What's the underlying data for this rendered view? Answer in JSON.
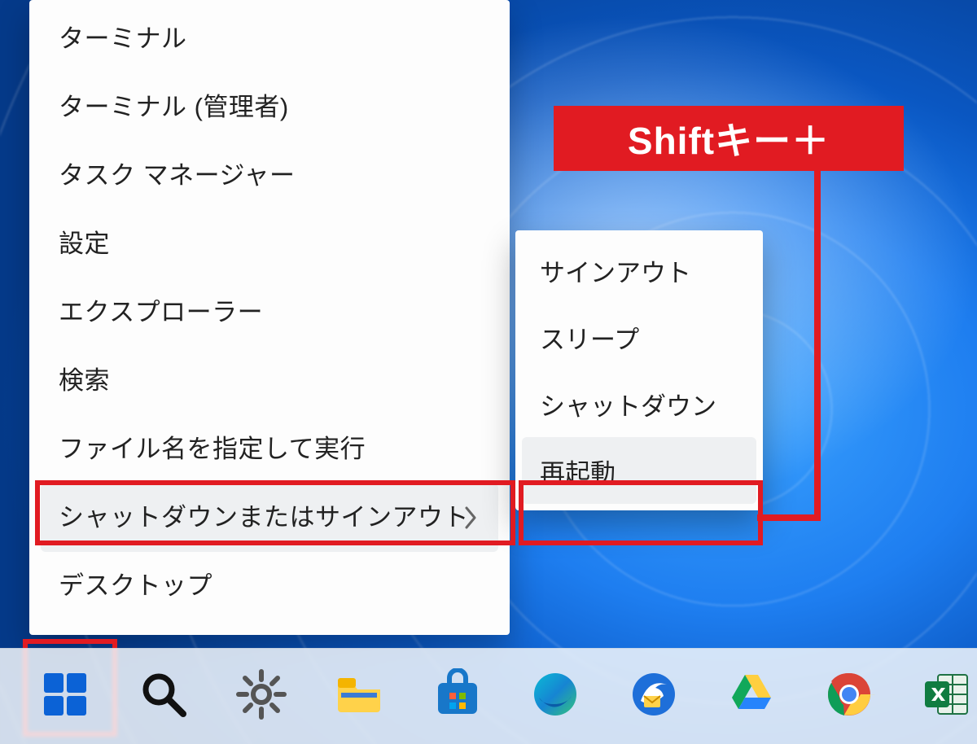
{
  "annotation": {
    "callout_text": "Shiftキー＋"
  },
  "quick_menu": {
    "items": [
      {
        "label": "ターミナル"
      },
      {
        "label": "ターミナル (管理者)"
      },
      {
        "label": "タスク マネージャー"
      },
      {
        "label": "設定"
      },
      {
        "label": "エクスプローラー"
      },
      {
        "label": "検索"
      },
      {
        "label": "ファイル名を指定して実行"
      },
      {
        "label": "シャットダウンまたはサインアウト",
        "has_submenu": true,
        "hover": true
      },
      {
        "label": "デスクトップ"
      }
    ]
  },
  "submenu": {
    "items": [
      {
        "label": "サインアウト"
      },
      {
        "label": "スリープ"
      },
      {
        "label": "シャットダウン"
      },
      {
        "label": "再起動",
        "hover": true
      }
    ]
  },
  "taskbar": {
    "items": [
      {
        "name": "start-button",
        "icon": "windows-icon"
      },
      {
        "name": "search-button",
        "icon": "search-icon"
      },
      {
        "name": "settings-button",
        "icon": "gear-icon"
      },
      {
        "name": "explorer-button",
        "icon": "folder-icon"
      },
      {
        "name": "store-button",
        "icon": "store-icon"
      },
      {
        "name": "edge-button",
        "icon": "edge-icon"
      },
      {
        "name": "thunderbird-button",
        "icon": "thunderbird-icon"
      },
      {
        "name": "drive-button",
        "icon": "googledrive-icon"
      },
      {
        "name": "chrome-button",
        "icon": "chrome-icon"
      },
      {
        "name": "excel-button",
        "icon": "excel-icon"
      }
    ]
  },
  "colors": {
    "highlight": "#e11b22",
    "menu_bg": "#fdfdfd",
    "hover_bg": "#eef0f2"
  }
}
